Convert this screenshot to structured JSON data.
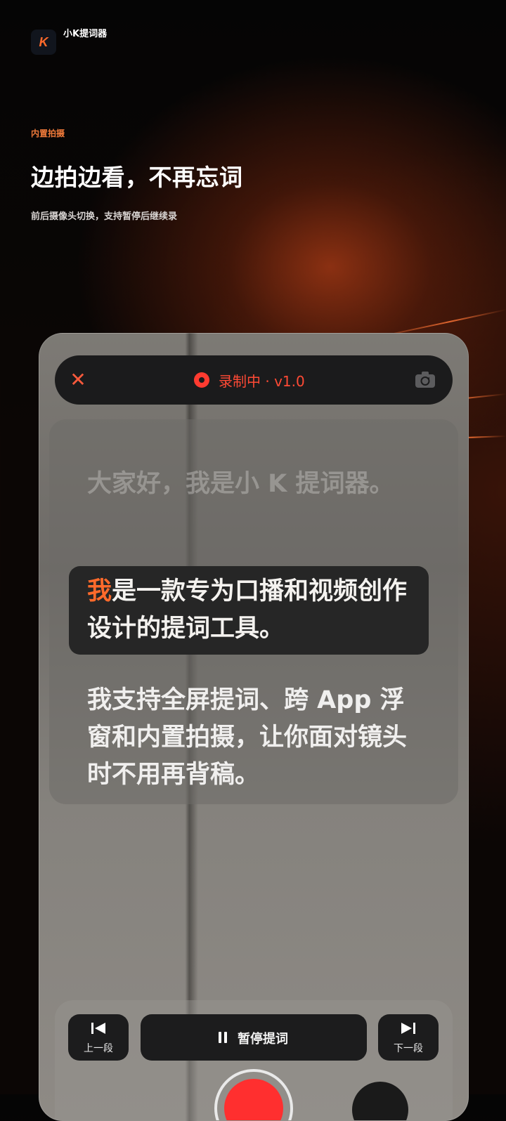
{
  "app": {
    "logo_glyph": "K",
    "name": "小K提词器"
  },
  "hero": {
    "eyebrow": "内置拍摄",
    "headline": "边拍边看，不再忘词",
    "subline": "前后摄像头切换，支持暂停后继续录"
  },
  "phone": {
    "top_bar": {
      "close_glyph": "✕",
      "status": "录制中 · v1.0"
    },
    "script": {
      "past": "大家好，我是小 K 提词器。",
      "active_highlight": "我",
      "active_rest": "是一款专为口播和视频创作设计的提词工具。",
      "next": "我支持全屏提词、跨 App 浮窗和内置拍摄，让你面对镜头时不用再背稿。"
    },
    "controls": {
      "prev_label": "上一段",
      "main_label": "暂停提词",
      "next_label": "下一段"
    }
  },
  "colors": {
    "accent": "#ff6a2b",
    "record": "#ff3b30",
    "status": "#ff4a35"
  }
}
